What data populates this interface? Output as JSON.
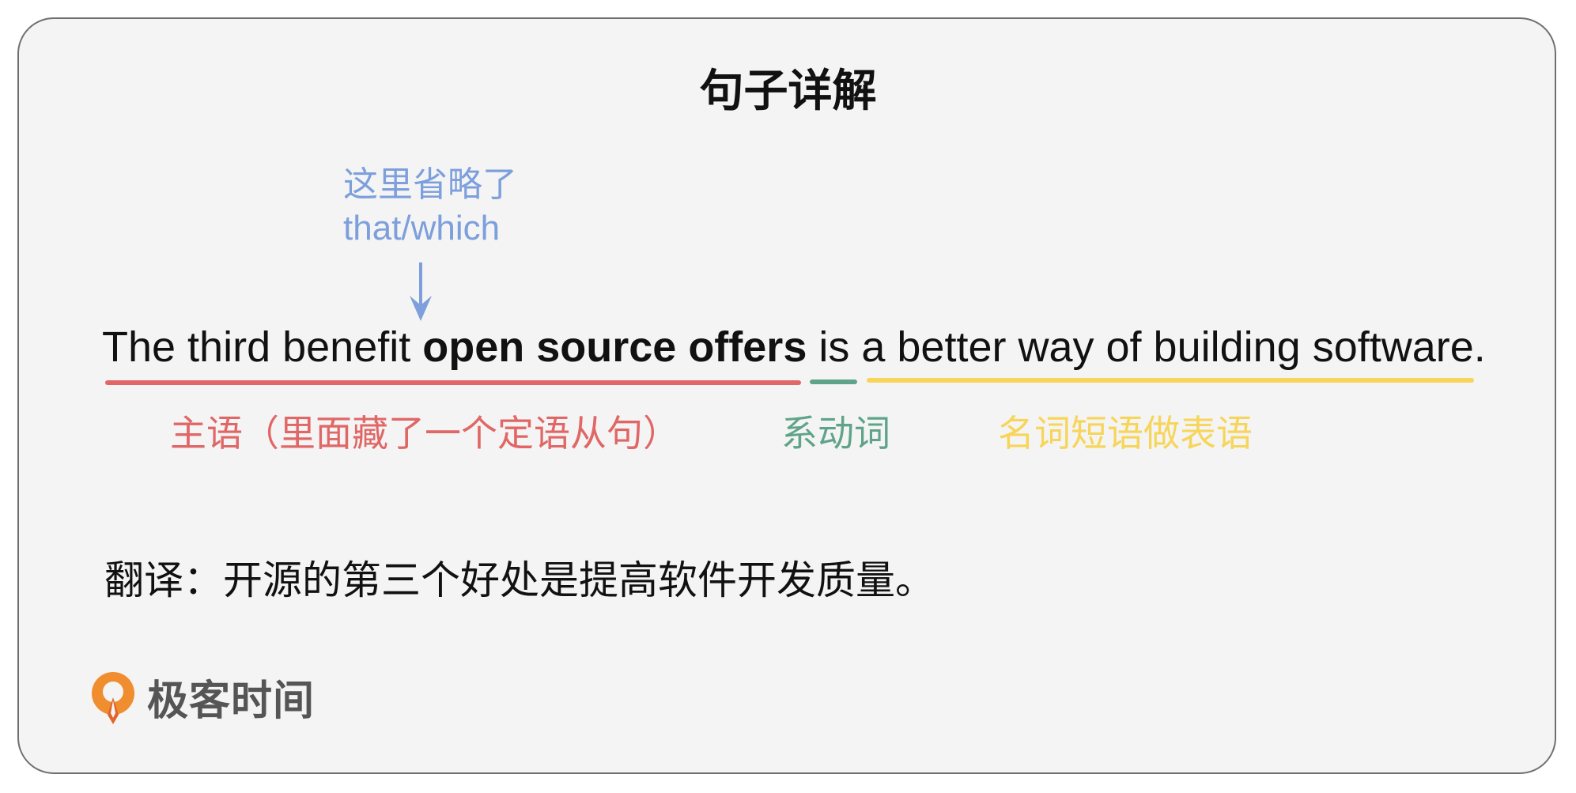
{
  "title": "句子详解",
  "note": {
    "line1": "这里省略了",
    "line2": "that/which"
  },
  "sentence": {
    "part1": "The third benefit ",
    "bold": "open source offers",
    "part2": " is a better way of building software."
  },
  "labels": {
    "subject": "主语（里面藏了一个定语从句）",
    "verb": "系动词",
    "predicative": "名词短语做表语"
  },
  "translation": "翻译：开源的第三个好处是提高软件开发质量。",
  "brand": "极客时间",
  "colors": {
    "subject": "#e06766",
    "verb": "#5ea38a",
    "predicative": "#f7d55a",
    "note": "#7d9fdc",
    "logo": "#f08d2e"
  }
}
